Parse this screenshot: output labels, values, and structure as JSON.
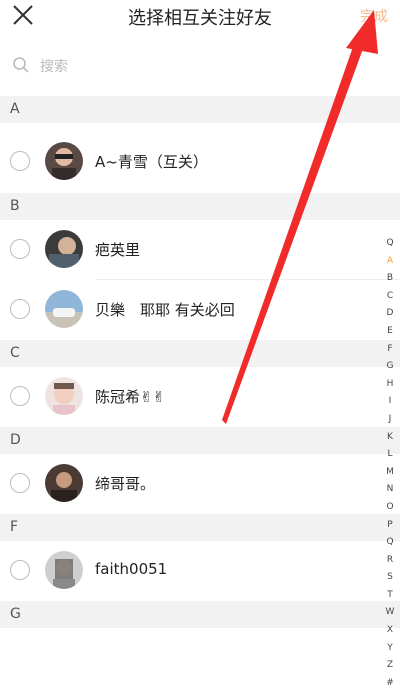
{
  "header": {
    "title": "选择相互关注好友",
    "done_label": "完成"
  },
  "search": {
    "placeholder": "搜索"
  },
  "sections": [
    "A",
    "B",
    "C",
    "D",
    "F",
    "G"
  ],
  "contacts": [
    {
      "name": "A~青雪（互关）"
    },
    {
      "name": "疤英里"
    },
    {
      "name": "贝樂　耶耶 有关必回"
    },
    {
      "name": "陈冠希✌✌"
    },
    {
      "name": "缔哥哥。"
    },
    {
      "name": "faith0051"
    }
  ],
  "index": {
    "active": "A",
    "letters": [
      "Q",
      "A",
      "B",
      "C",
      "D",
      "E",
      "F",
      "G",
      "H",
      "I",
      "J",
      "K",
      "L",
      "M",
      "N",
      "O",
      "P",
      "Q",
      "R",
      "S",
      "T",
      "W",
      "X",
      "Y",
      "Z",
      "#"
    ]
  },
  "colors": {
    "accent": "#f5b98a",
    "arrow": "#f12a2a",
    "section_bg": "#f2f2f2"
  }
}
